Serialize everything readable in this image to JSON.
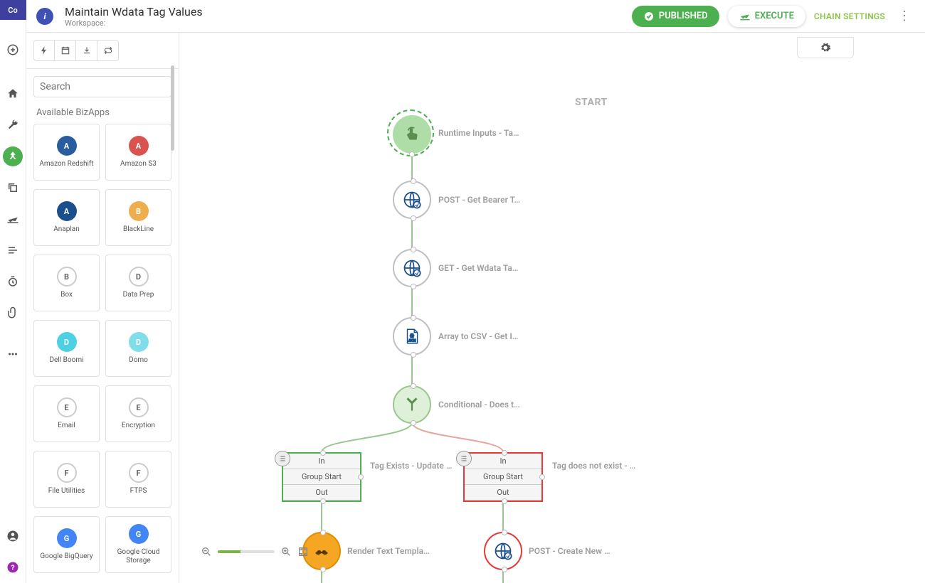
{
  "header": {
    "title": "Maintain Wdata Tag Values",
    "workspace_label": "Workspace:",
    "published_label": "PUBLISHED",
    "execute_label": "EXECUTE",
    "settings_label": "CHAIN SETTINGS"
  },
  "sidebar": {
    "search_placeholder": "Search",
    "section_title": "Available BizApps",
    "cards": [
      {
        "label": "Amazon Redshift",
        "color": "#2a5d9f"
      },
      {
        "label": "Amazon S3",
        "color": "#d9534f"
      },
      {
        "label": "Anaplan",
        "color": "#1b4f8b"
      },
      {
        "label": "BlackLine",
        "color": "#f0ad4e"
      },
      {
        "label": "Box",
        "color": "#2a9fd6"
      },
      {
        "label": "Data Prep",
        "color": "#999"
      },
      {
        "label": "Dell Boomi",
        "color": "#4dd0e1"
      },
      {
        "label": "Domo",
        "color": "#80deea"
      },
      {
        "label": "Email",
        "color": "#ccc"
      },
      {
        "label": "Encryption",
        "color": "#ccc"
      },
      {
        "label": "File Utilities",
        "color": "#ccc"
      },
      {
        "label": "FTPS",
        "color": "#ccc"
      },
      {
        "label": "Google BigQuery",
        "color": "#4285f4"
      },
      {
        "label": "Google Cloud Storage",
        "color": "#4285f4"
      }
    ]
  },
  "canvas": {
    "start_label": "START",
    "nodes": {
      "trigger": "Runtime Inputs - Ta…",
      "n1": "POST - Get Bearer T…",
      "n2": "GET - Get Wdata Ta…",
      "n3": "Array to CSV - Get I…",
      "cond": "Conditional - Does t…",
      "g1_label": "Tag Exists - Update …",
      "g2_label": "Tag does not exist - …",
      "g_in": "In",
      "g_start": "Group Start",
      "g_out": "Out",
      "left_leaf": "Render Text Templa…",
      "right_leaf": "POST - Create New …"
    }
  }
}
